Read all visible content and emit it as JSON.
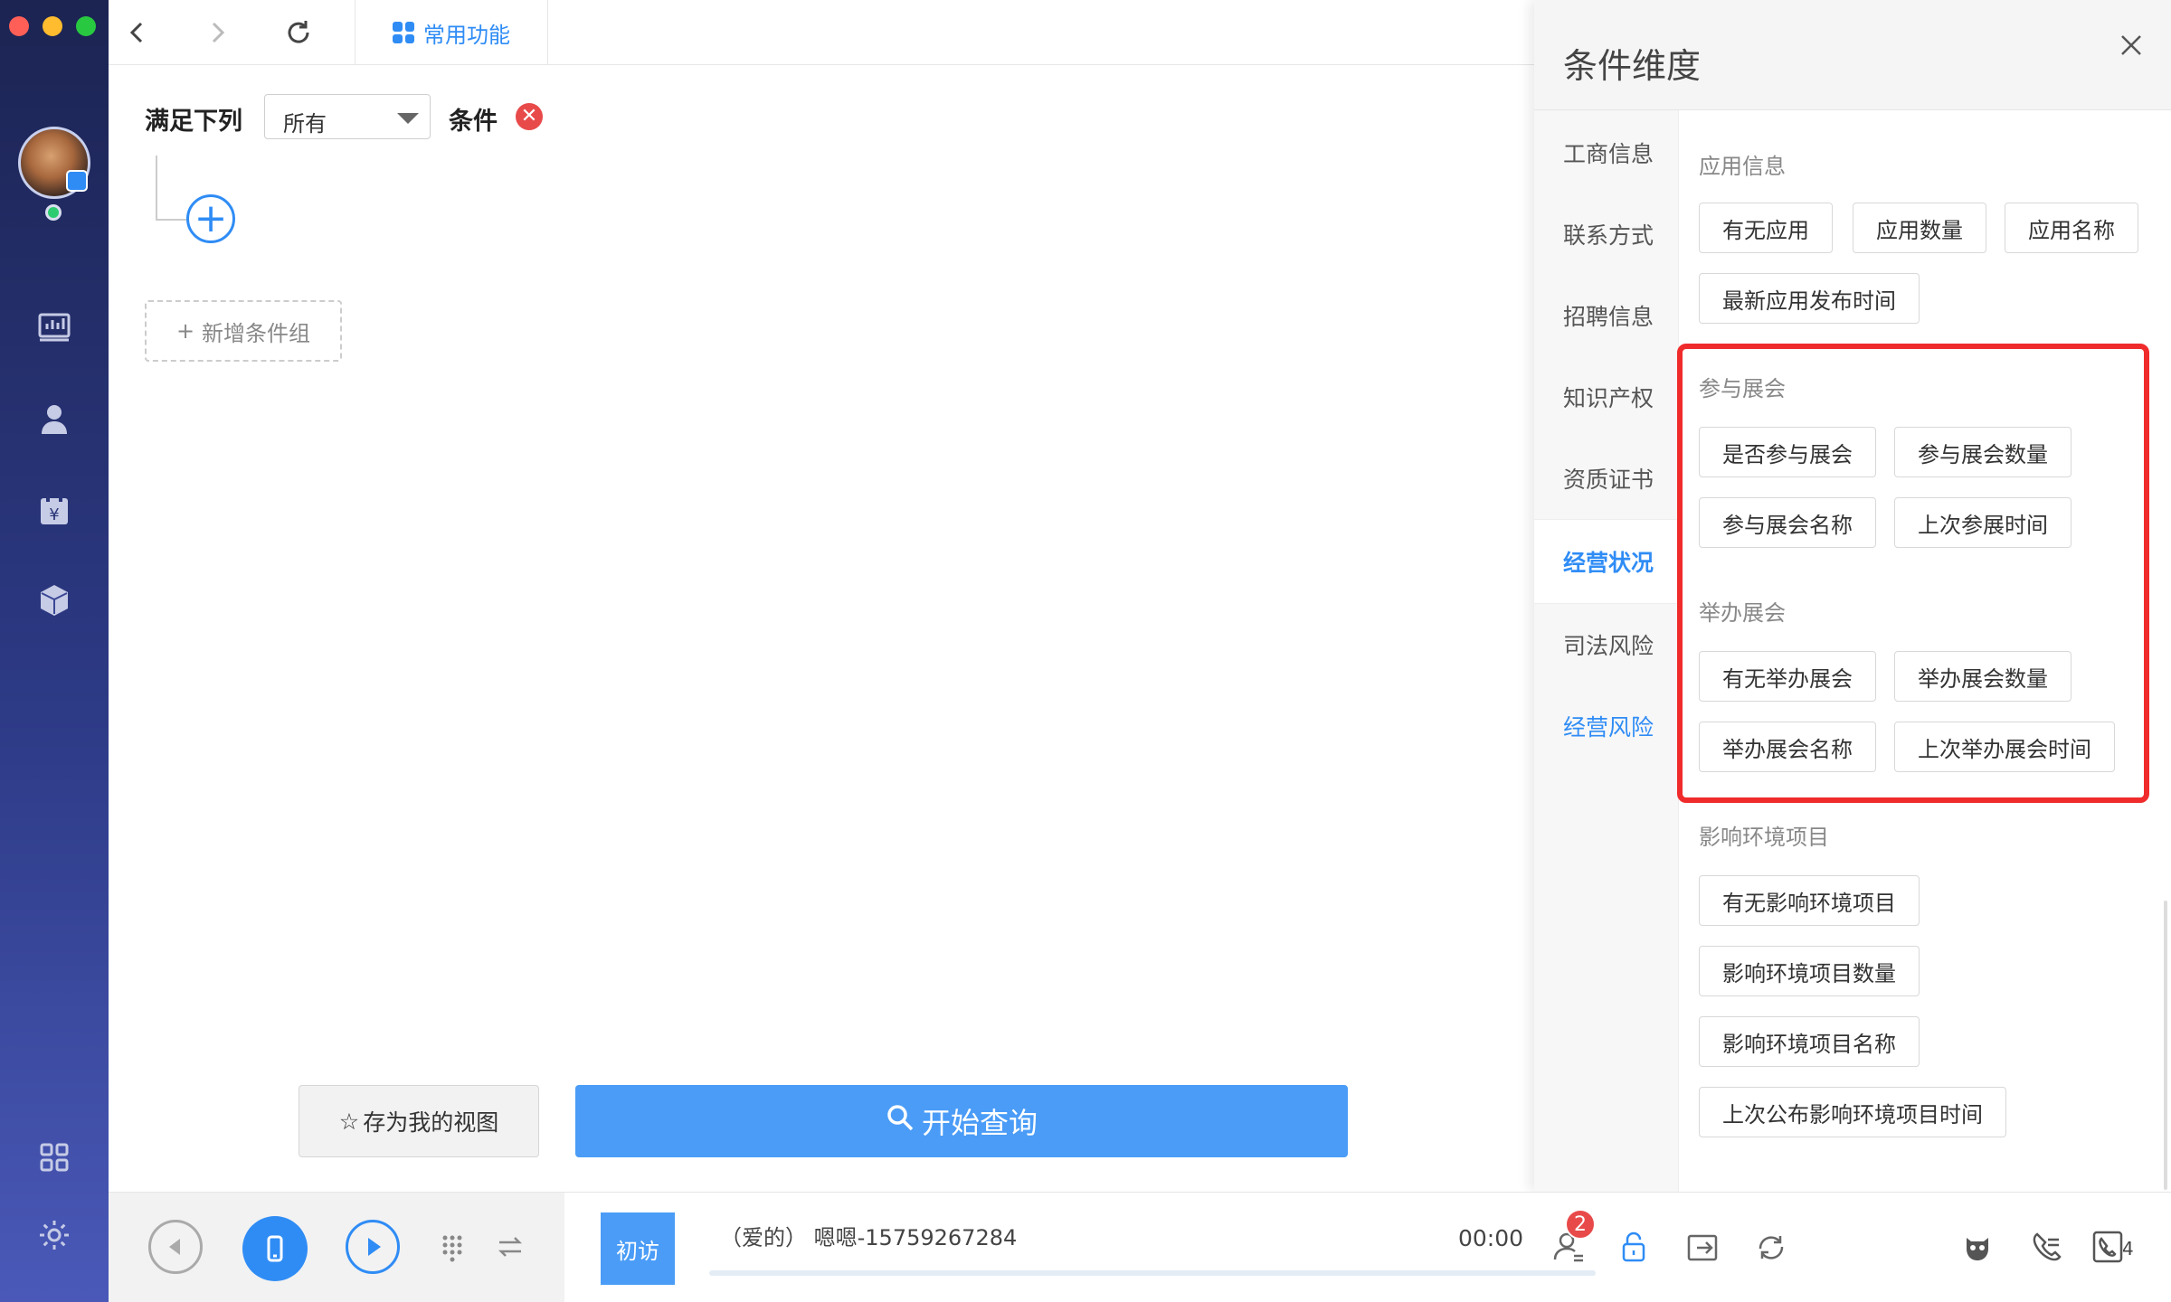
{
  "topbar": {
    "tab_label": "常用功能"
  },
  "filter": {
    "prefix_label": "满足下列",
    "match_select": "所有",
    "suffix_label": "条件",
    "remove_symbol": "✕",
    "add_symbol": "+",
    "add_group_label": "新增条件组",
    "add_group_symbol": "+"
  },
  "actions": {
    "save_view_label": "存为我的视图",
    "save_view_symbol": "☆",
    "start_query_label": "开始查询"
  },
  "panel": {
    "title": "条件维度",
    "nav": [
      "工商信息",
      "联系方式",
      "招聘信息",
      "知识产权",
      "资质证书",
      "经营状况",
      "司法风险",
      "经营风险"
    ],
    "active_nav": "经营状况",
    "sections": [
      {
        "title": "应用信息",
        "items": [
          "有无应用",
          "应用数量",
          "应用名称",
          "最新应用发布时间"
        ]
      },
      {
        "title": "参与展会",
        "items": [
          "是否参与展会",
          "参与展会数量",
          "参与展会名称",
          "上次参展时间"
        ]
      },
      {
        "title": "举办展会",
        "items": [
          "有无举办展会",
          "举办展会数量",
          "举办展会名称",
          "上次举办展会时间"
        ]
      },
      {
        "title": "影响环境项目",
        "items": [
          "有无影响环境项目",
          "影响环境项目数量",
          "影响环境项目名称",
          "上次公布影响环境项目时间"
        ]
      }
    ]
  },
  "callbar": {
    "visit_badge": "初访",
    "contact": "（爱的）  嗯嗯-15759267284",
    "timer": "00:00",
    "notification_count": "2",
    "line_count": "4"
  },
  "icons": {
    "sidebar": [
      "dashboard-icon",
      "user-icon",
      "calendar-yen-icon",
      "cube-icon",
      "apps-grid-icon",
      "settings-icon"
    ],
    "callbar": [
      "prev-icon",
      "mobile-phone-icon",
      "play-icon",
      "keypad-icon",
      "switch-icon",
      "contact-icon",
      "lock-icon",
      "transfer-icon",
      "repeat-call-icon",
      "robot-icon",
      "call-log-icon",
      "phone-line-icon"
    ]
  },
  "colors": {
    "accent": "#2f8cf5",
    "highlight_box": "#f02b2b",
    "sidebar_top": "#1c2452",
    "sidebar_bottom": "#4a59b8"
  }
}
